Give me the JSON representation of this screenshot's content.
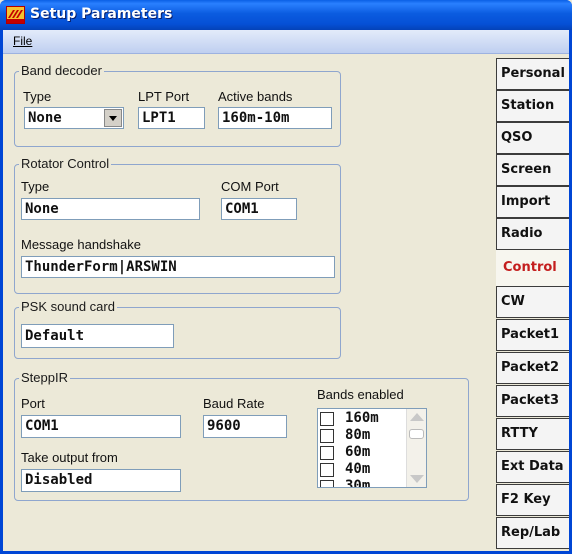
{
  "window": {
    "title": "Setup Parameters"
  },
  "menu": {
    "file": "File"
  },
  "band_decoder": {
    "legend": "Band decoder",
    "type_label": "Type",
    "type_value": "None",
    "lpt_label": "LPT Port",
    "lpt_value": "LPT1",
    "bands_label": "Active bands",
    "bands_value": "160m-10m"
  },
  "rotator": {
    "legend": "Rotator Control",
    "type_label": "Type",
    "type_value": "None",
    "com_label": "COM Port",
    "com_value": "COM1",
    "handshake_label": "Message handshake",
    "handshake_value": "ThunderForm|ARSWIN"
  },
  "psk": {
    "legend": "PSK sound card",
    "value": "Default"
  },
  "steppir": {
    "legend": "SteppIR",
    "port_label": "Port",
    "port_value": "COM1",
    "baud_label": "Baud Rate",
    "baud_value": "9600",
    "output_label": "Take output from",
    "output_value": "Disabled",
    "bands_label": "Bands enabled",
    "bands": [
      "160m",
      "80m",
      "60m",
      "40m",
      "30m"
    ]
  },
  "tabs": [
    "Personal",
    "Station",
    "QSO",
    "Screen",
    "Import",
    "Radio",
    "Control",
    "CW",
    "Packet1",
    "Packet2",
    "Packet3",
    "RTTY",
    "Ext Data",
    "F2 Key",
    "Rep/Lab"
  ],
  "active_tab": "Control"
}
